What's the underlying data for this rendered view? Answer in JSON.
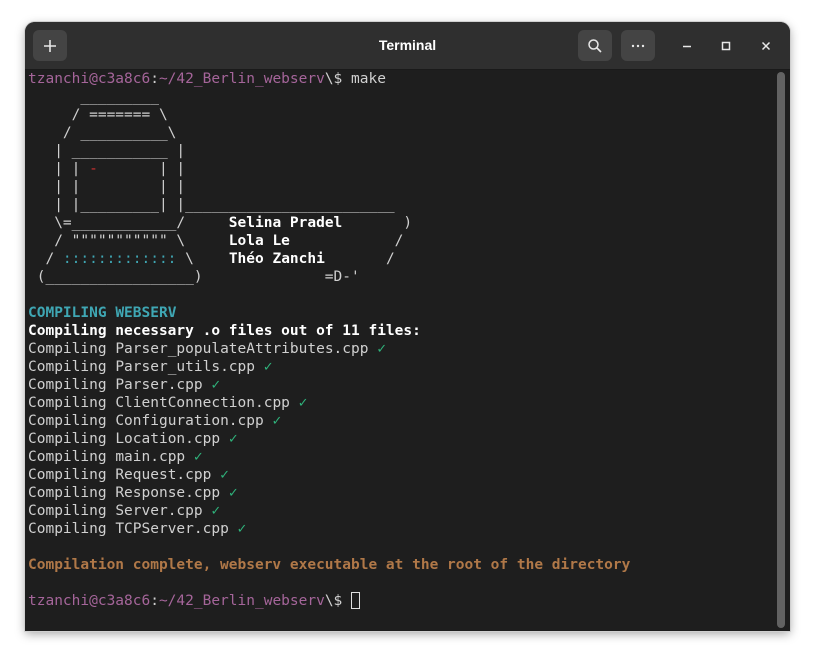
{
  "window": {
    "title": "Terminal"
  },
  "titlebar": {
    "new_tab_icon": "plus-icon",
    "search_icon": "search-icon",
    "menu_icon": "ellipsis-icon",
    "minimize_icon": "minimize-icon",
    "maximize_icon": "maximize-icon",
    "close_icon": "close-icon"
  },
  "prompt": {
    "user_host": "tzanchi@c3a8c6",
    "sep": ":",
    "path": "~/42_Berlin_webserv",
    "dollar": "\\$ "
  },
  "command": "make",
  "banner": [
    "      _________",
    "     / ======= \\",
    "    / __________\\",
    "   | ___________ |",
    "   | | -       | |",
    "   | |         | |",
    "   | |_________| |________________________",
    "   \\=____________/     Selina Pradel       )",
    "   / \"\"\"\"\"\"\"\"\"\"\" \\     Lola Le            /",
    "  / ::::::::::::: \\    Théo Zanchi       /",
    " (_________________)              =D-'"
  ],
  "banner_parts": {
    "line4_pre": "   | | ",
    "line4_dash": "-",
    "line4_post": "       | |",
    "line9_pre": "  / ",
    "line9_dots": ":::::::::::::",
    "line9_post": " \\    ",
    "name1_pre": "   \\=____________/     ",
    "name1": "Selina Pradel",
    "name1_post": "       )",
    "name2_pre": "   / \"\"\"\"\"\"\"\"\"\"\" \\     ",
    "name2": "Lola Le",
    "name2_post": "            /",
    "name3": "Théo Zanchi",
    "name3_post": "       /"
  },
  "heading": {
    "left": "COMPILING",
    "right": "WEBSERV"
  },
  "subheading": "Compiling necessary .o files out of 11 files:",
  "compile_prefix": "Compiling",
  "checkmark": "✓",
  "files": [
    "Parser_populateAttributes.cpp",
    "Parser_utils.cpp",
    "Parser.cpp",
    "ClientConnection.cpp",
    "Configuration.cpp",
    "Location.cpp",
    "main.cpp",
    "Request.cpp",
    "Response.cpp",
    "Server.cpp",
    "TCPServer.cpp"
  ],
  "complete_message": "Compilation complete, webserv executable at the root of the directory",
  "colors": {
    "prompt": "#a5659a",
    "heading": "#3fa7b4",
    "message": "#b07848",
    "check": "#2fb47c",
    "accent_red": "#d03030"
  }
}
